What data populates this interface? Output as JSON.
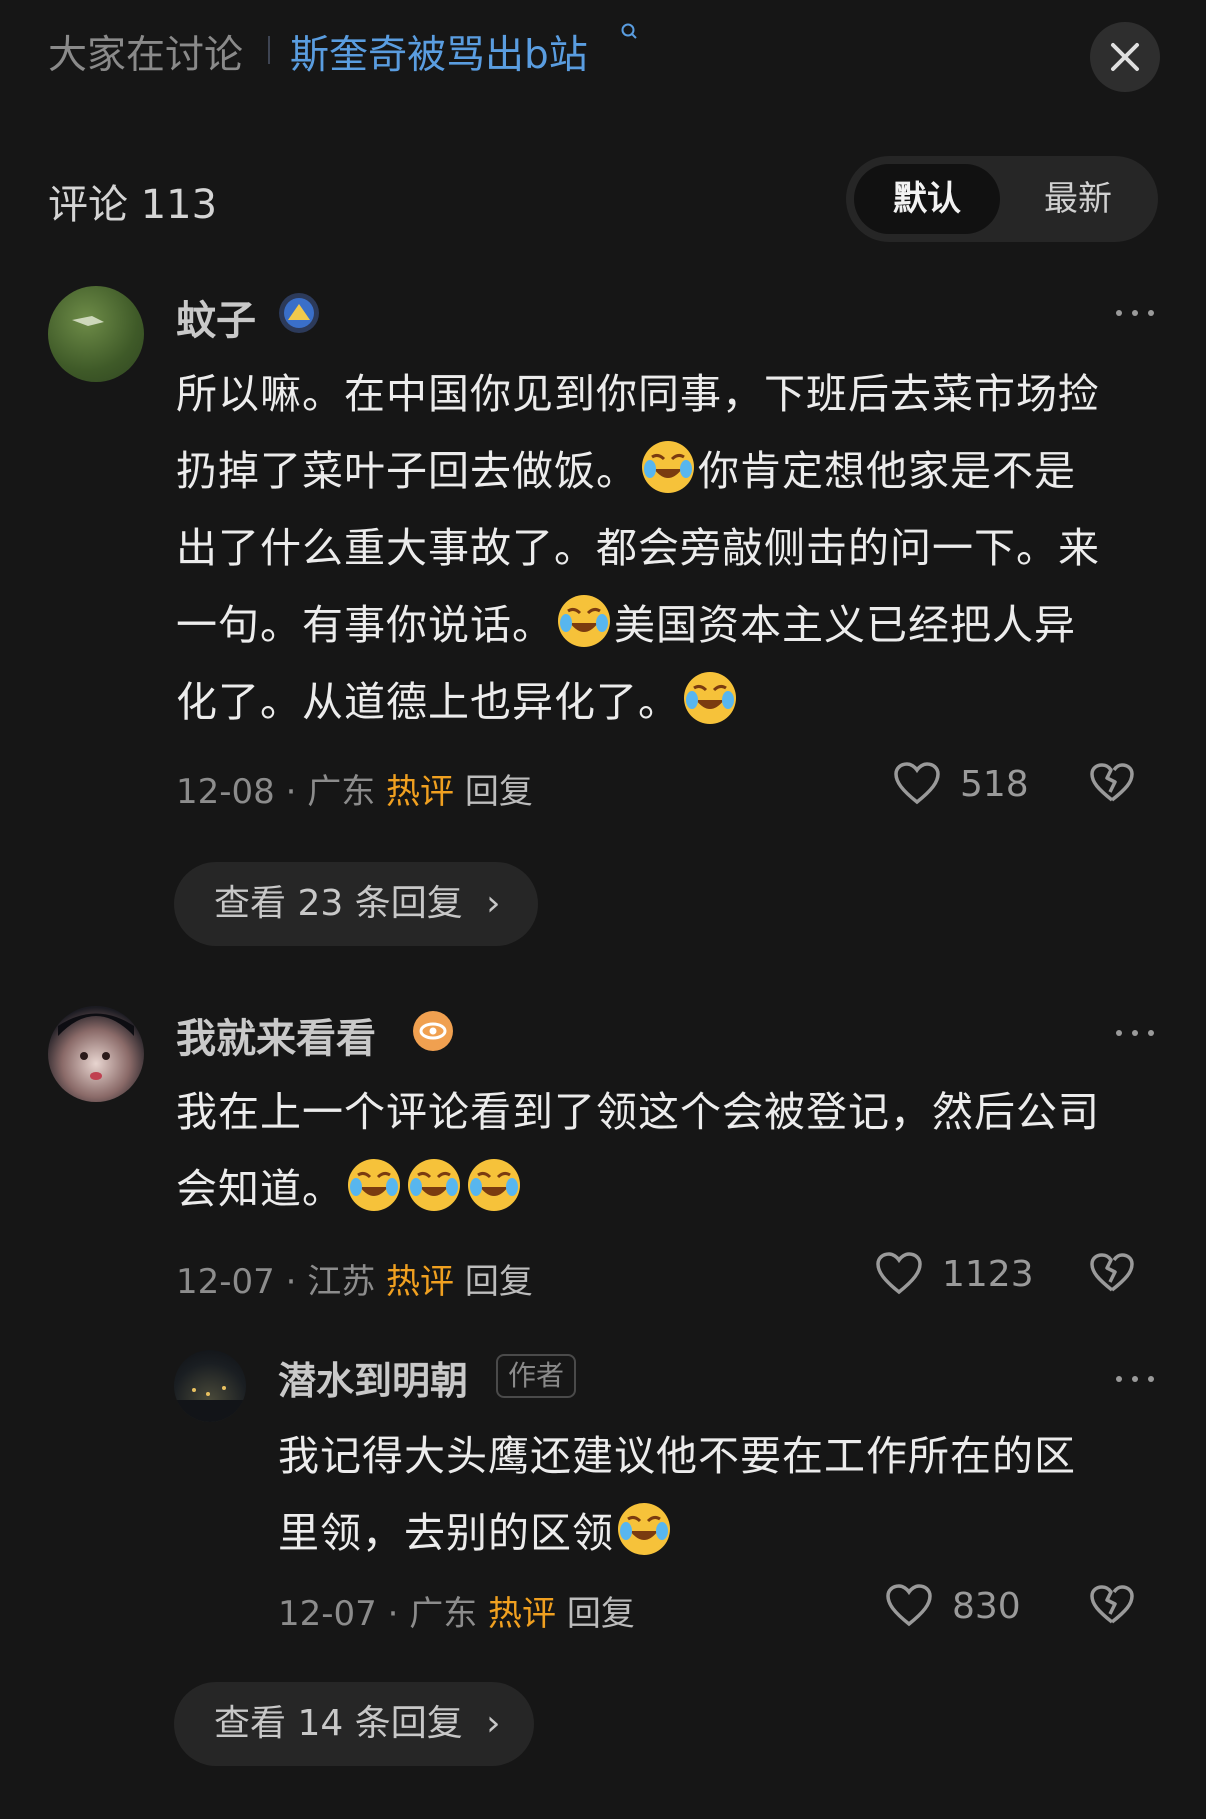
{
  "topic": {
    "prefix": "大家在讨论",
    "title": "斯奎奇被骂出b站"
  },
  "header": {
    "comments_label": "评论 113",
    "sort_default": "默认",
    "sort_latest": "最新"
  },
  "comments": [
    {
      "username": "蚊子",
      "badge_icon": "level-badge-icon",
      "lines": [
        "所以嘛。在中国你见到你同事，下班后去菜市场捡",
        "扔掉了菜叶子回去做饭。",
        "你肯定想他家是不是",
        "出了什么重大事故了。都会旁敲侧击的问一下。来",
        "一句。有事你说话。",
        "美国资本主义已经把人异",
        "化了。从道德上也异化了。"
      ],
      "date": "12-08",
      "location": "广东",
      "hot": "热评",
      "reply": "回复",
      "likes": "518",
      "view_replies": "查看 23 条回复"
    },
    {
      "username": "我就来看看",
      "badge_icon": "eye-badge-icon",
      "lines": [
        "我在上一个评论看到了领这个会被登记，然后公司",
        "会知道。"
      ],
      "date": "12-07",
      "location": "江苏",
      "hot": "热评",
      "reply": "回复",
      "likes": "1123",
      "view_replies": "查看 14 条回复",
      "sub_reply": {
        "username": "潜水到明朝",
        "author_tag": "作者",
        "lines": [
          "我记得大头鹰还建议他不要在工作所在的区",
          "里领，去别的区领"
        ],
        "date": "12-07",
        "location": "广东",
        "hot": "热评",
        "reply": "回复",
        "likes": "830"
      }
    }
  ],
  "colors": {
    "hot": "#f0a020",
    "link": "#5a9de0",
    "background": "#161616"
  },
  "icons": {
    "emoji": "laugh-cry-emoji",
    "like": "heart-icon",
    "dislike": "broken-heart-icon",
    "close": "close-icon",
    "more": "more-dots-icon"
  }
}
